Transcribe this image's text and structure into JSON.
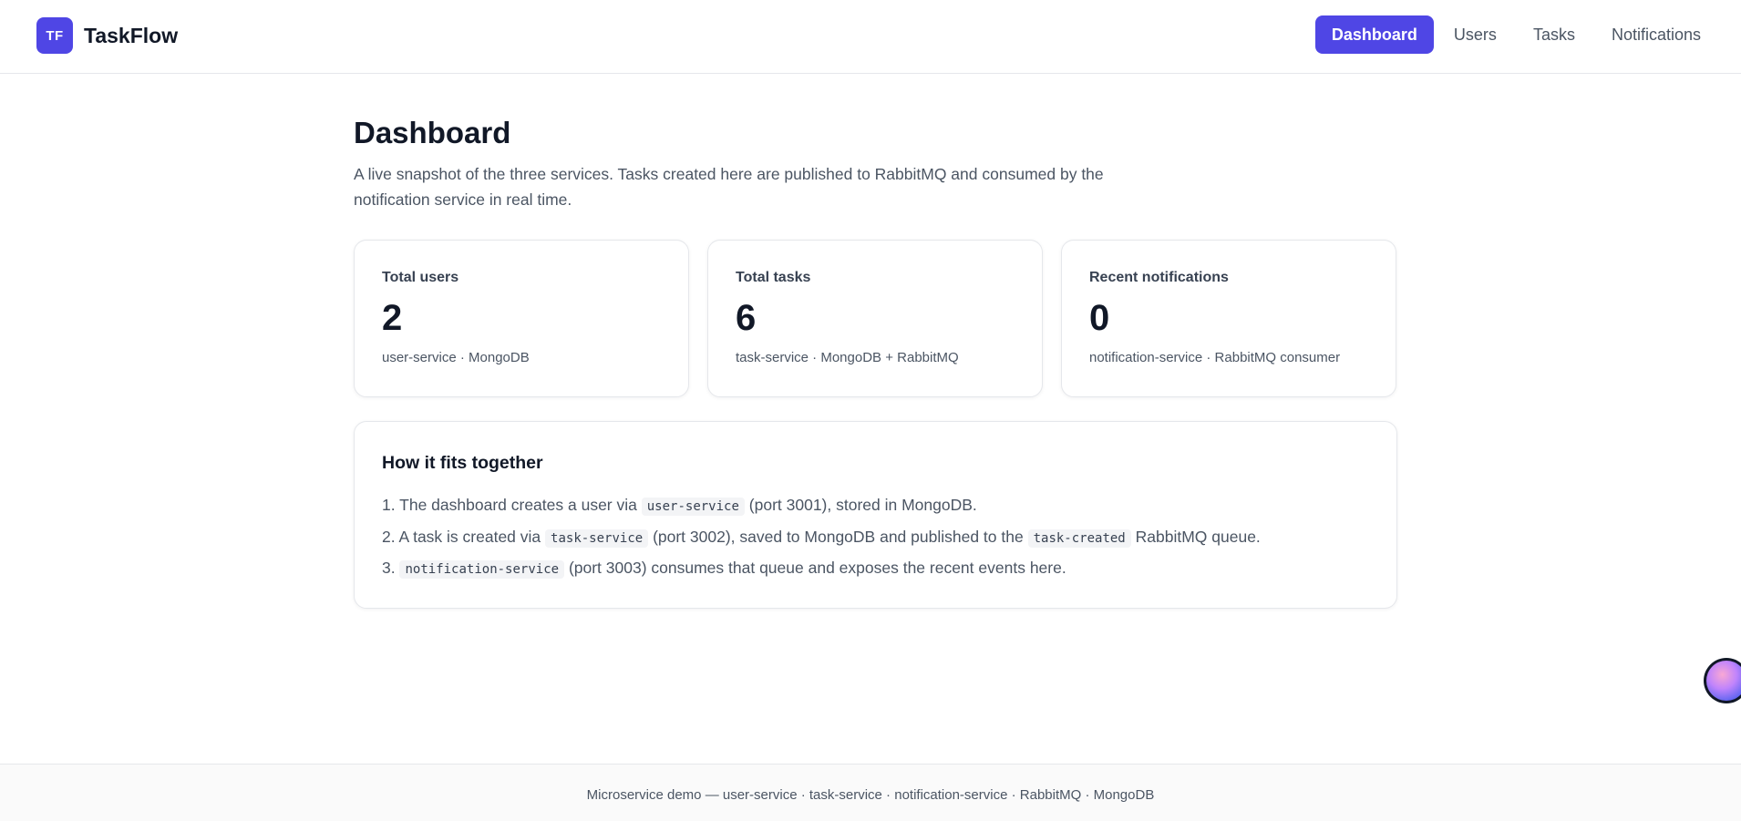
{
  "brand": {
    "logo_text": "TF",
    "name": "TaskFlow"
  },
  "nav": {
    "items": [
      {
        "label": "Dashboard",
        "active": true
      },
      {
        "label": "Users",
        "active": false
      },
      {
        "label": "Tasks",
        "active": false
      },
      {
        "label": "Notifications",
        "active": false
      }
    ]
  },
  "page": {
    "title": "Dashboard",
    "description": "A live snapshot of the three services. Tasks created here are published to RabbitMQ and consumed by the notification service in real time."
  },
  "stats": [
    {
      "label": "Total users",
      "value": "2",
      "sub": "user-service · MongoDB"
    },
    {
      "label": "Total tasks",
      "value": "6",
      "sub": "task-service · MongoDB + RabbitMQ"
    },
    {
      "label": "Recent notifications",
      "value": "0",
      "sub": "notification-service · RabbitMQ consumer"
    }
  ],
  "how": {
    "title": "How it fits together",
    "steps": [
      {
        "n": "1.",
        "a": "The dashboard creates a user via",
        "code1": "user-service",
        "b": "(port 3001), stored in MongoDB."
      },
      {
        "n": "2.",
        "a": "A task is created via",
        "code1": "task-service",
        "b": "(port 3002), saved to MongoDB and published to the",
        "code2": "task-created",
        "c": "RabbitMQ queue."
      },
      {
        "n": "3.",
        "code1": "notification-service",
        "b": "(port 3003) consumes that queue and exposes the recent events here."
      }
    ]
  },
  "footer": {
    "text": "Microservice demo — user-service · task-service · notification-service · RabbitMQ · MongoDB"
  },
  "colors": {
    "accent": "#4f46e5",
    "text": "#111827",
    "muted": "#4b5563",
    "border": "#e5e7eb"
  },
  "icons": {
    "chat_widget": "assistant-avatar-icon"
  }
}
